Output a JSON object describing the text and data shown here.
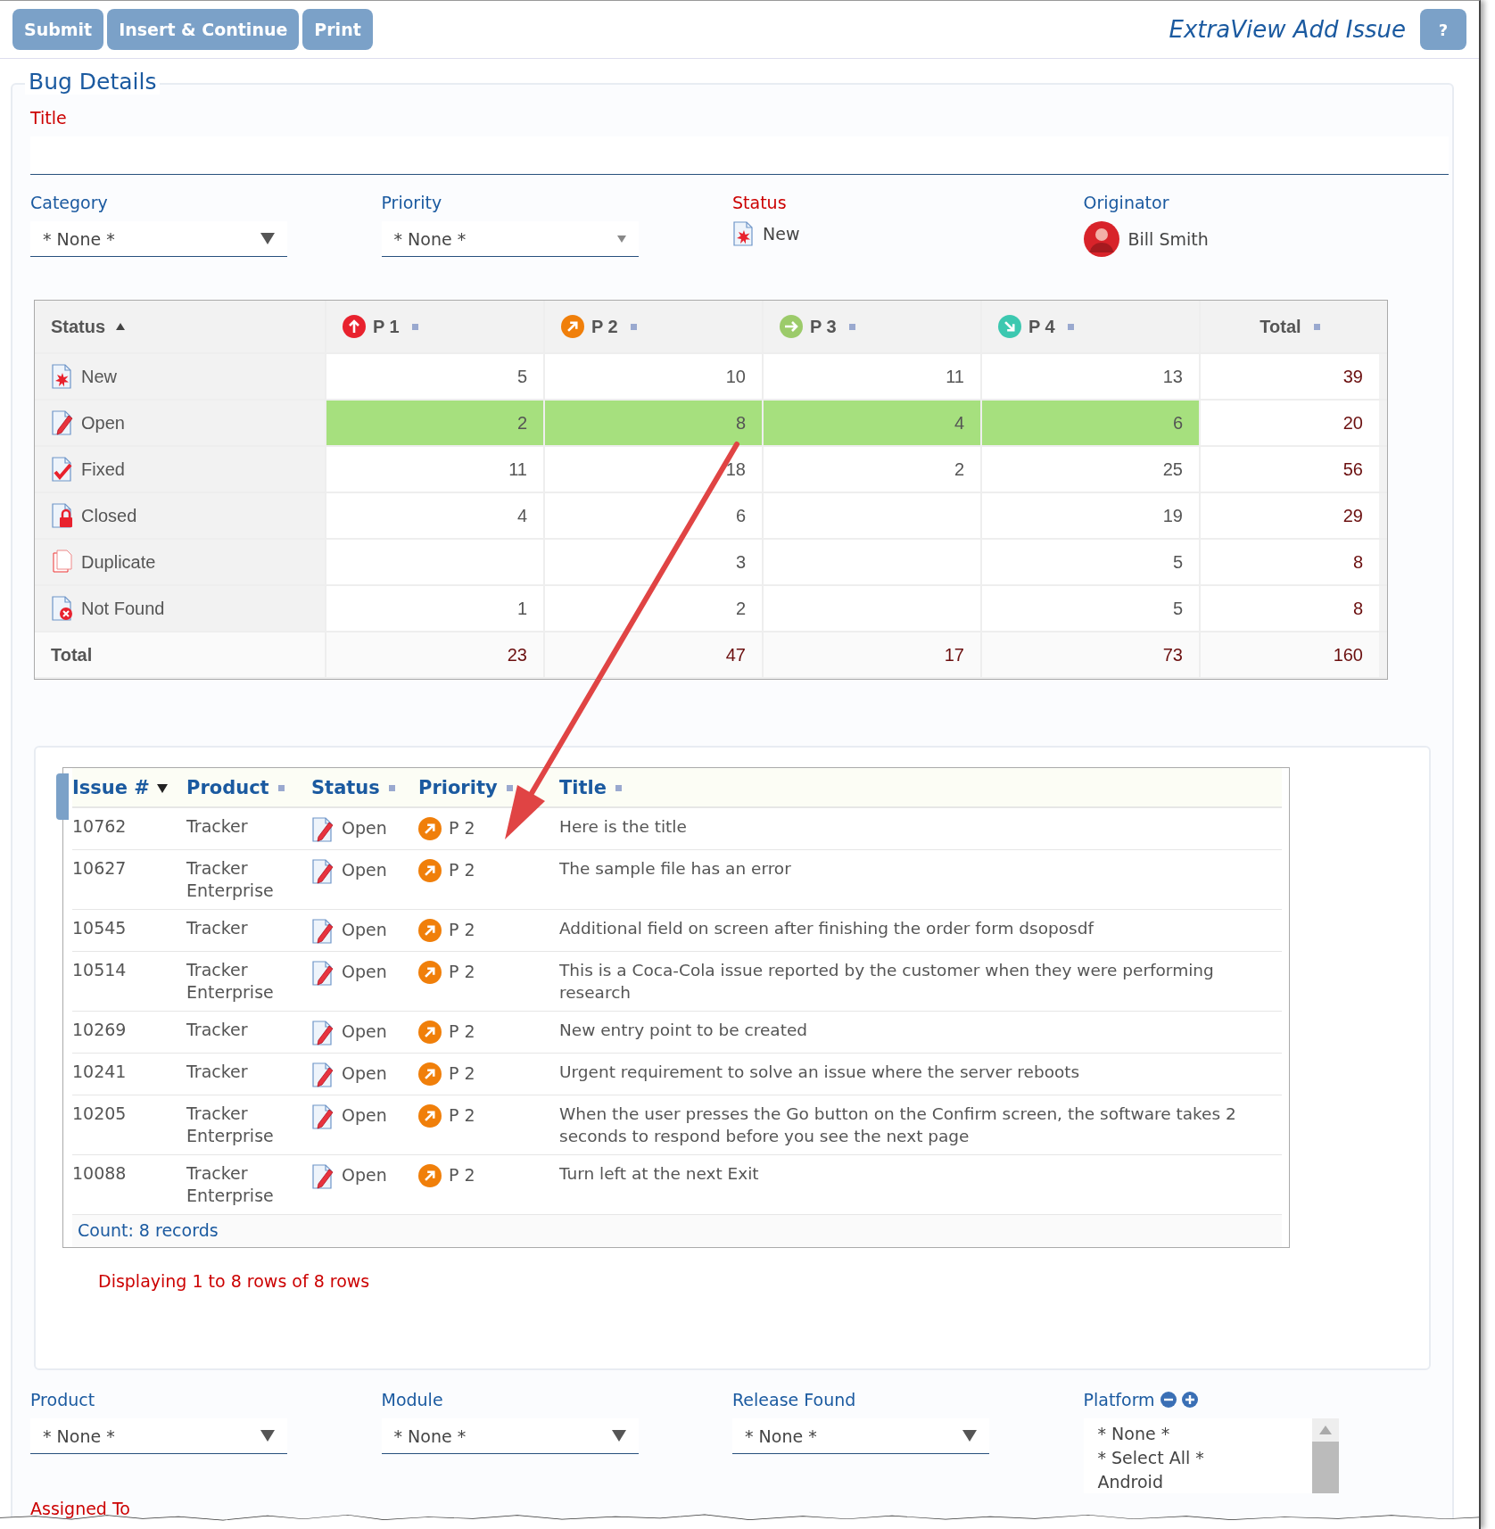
{
  "toolbar": {
    "buttons": [
      "Submit",
      "Insert & Continue",
      "Print"
    ],
    "title": "ExtraView Add Issue",
    "help": "?"
  },
  "section": {
    "title": "Bug Details"
  },
  "title_field": {
    "label": "Title",
    "required": true
  },
  "fields": [
    {
      "label": "Category",
      "required": false,
      "kind": "dropdown",
      "value": "* None *"
    },
    {
      "label": "Priority",
      "required": false,
      "kind": "dropdown_small",
      "value": "* None *"
    },
    {
      "label": "Status",
      "required": true,
      "kind": "status",
      "status": {
        "label": "New",
        "kind": "new"
      }
    },
    {
      "label": "Originator",
      "required": false,
      "kind": "user",
      "value": "Bill Smith"
    }
  ],
  "pivot": {
    "columns": [
      {
        "label": "Status",
        "kind": "status",
        "sorted": true,
        "descending": false
      },
      {
        "label": "P 1",
        "kind": "p1",
        "sorted": false
      },
      {
        "label": "P 2",
        "kind": "p2",
        "sorted": false
      },
      {
        "label": "P 3",
        "kind": "p3",
        "sorted": false
      },
      {
        "label": "P 4",
        "kind": "p4",
        "sorted": false
      },
      {
        "label": "Total",
        "kind": "total",
        "sorted": false
      }
    ],
    "rows": [
      {
        "label": "New",
        "kind": "new",
        "cells": [
          {
            "value": "5",
            "highlighted": false
          },
          {
            "value": "10",
            "highlighted": false
          },
          {
            "value": "11",
            "highlighted": false
          },
          {
            "value": "13",
            "highlighted": false
          },
          {
            "value": "39",
            "highlighted": false
          }
        ]
      },
      {
        "label": "Open",
        "kind": "open",
        "cells": [
          {
            "value": "2",
            "highlighted": true
          },
          {
            "value": "8",
            "highlighted": true
          },
          {
            "value": "4",
            "highlighted": true
          },
          {
            "value": "6",
            "highlighted": true
          },
          {
            "value": "20",
            "highlighted": false
          }
        ]
      },
      {
        "label": "Fixed",
        "kind": "fixed",
        "cells": [
          {
            "value": "11",
            "highlighted": false
          },
          {
            "value": "18",
            "highlighted": false
          },
          {
            "value": "2",
            "highlighted": false
          },
          {
            "value": "25",
            "highlighted": false
          },
          {
            "value": "56",
            "highlighted": false
          }
        ]
      },
      {
        "label": "Closed",
        "kind": "closed",
        "cells": [
          {
            "value": "4",
            "highlighted": false
          },
          {
            "value": "6",
            "highlighted": false
          },
          {
            "highlighted": false
          },
          {
            "value": "19",
            "highlighted": false
          },
          {
            "value": "29",
            "highlighted": false
          }
        ]
      },
      {
        "label": "Duplicate",
        "kind": "duplicate",
        "cells": [
          {
            "highlighted": false
          },
          {
            "value": "3",
            "highlighted": false
          },
          {
            "highlighted": false
          },
          {
            "value": "5",
            "highlighted": false
          },
          {
            "value": "8",
            "highlighted": false
          }
        ]
      },
      {
        "label": "Not Found",
        "kind": "not_found",
        "cells": [
          {
            "value": "1",
            "highlighted": false
          },
          {
            "value": "2",
            "highlighted": false
          },
          {
            "highlighted": false
          },
          {
            "value": "5",
            "highlighted": false
          },
          {
            "value": "8",
            "highlighted": false
          }
        ]
      },
      {
        "label": "Total",
        "kind": "total",
        "cells": [
          {
            "value": "23",
            "highlighted": false
          },
          {
            "value": "47",
            "highlighted": false
          },
          {
            "value": "17",
            "highlighted": false
          },
          {
            "value": "73",
            "highlighted": false
          },
          {
            "value": "160",
            "highlighted": false
          }
        ]
      }
    ]
  },
  "issues": {
    "columns": [
      {
        "label": "Issue #",
        "sorted": true,
        "descending": true
      },
      {
        "label": "Product",
        "sorted": false
      },
      {
        "label": "Status",
        "sorted": false
      },
      {
        "label": "Priority",
        "sorted": false
      },
      {
        "label": "Title",
        "sorted": false
      }
    ],
    "rows": [
      {
        "issue": "10762",
        "product": "Tracker",
        "status": {
          "label": "Open",
          "kind": "open"
        },
        "priority": {
          "label": "P 2",
          "kind": "p2"
        },
        "title": "Here is the title"
      },
      {
        "issue": "10627",
        "product": "Tracker Enterprise",
        "status": {
          "label": "Open",
          "kind": "open"
        },
        "priority": {
          "label": "P 2",
          "kind": "p2"
        },
        "title": "The sample file has an error"
      },
      {
        "issue": "10545",
        "product": "Tracker",
        "status": {
          "label": "Open",
          "kind": "open"
        },
        "priority": {
          "label": "P 2",
          "kind": "p2"
        },
        "title": "Additional field on screen after finishing the order form dsoposdf"
      },
      {
        "issue": "10514",
        "product": "Tracker Enterprise",
        "status": {
          "label": "Open",
          "kind": "open"
        },
        "priority": {
          "label": "P 2",
          "kind": "p2"
        },
        "title": "This is a Coca-Cola issue reported by the customer when they were performing research"
      },
      {
        "issue": "10269",
        "product": "Tracker",
        "status": {
          "label": "Open",
          "kind": "open"
        },
        "priority": {
          "label": "P 2",
          "kind": "p2"
        },
        "title": "New entry point to be created"
      },
      {
        "issue": "10241",
        "product": "Tracker",
        "status": {
          "label": "Open",
          "kind": "open"
        },
        "priority": {
          "label": "P 2",
          "kind": "p2"
        },
        "title": "Urgent requirement to solve an issue where the server reboots"
      },
      {
        "issue": "10205",
        "product": "Tracker Enterprise",
        "status": {
          "label": "Open",
          "kind": "open"
        },
        "priority": {
          "label": "P 2",
          "kind": "p2"
        },
        "title": "When the user presses the Go button on the Confirm screen, the software takes 2 seconds to respond before you see the next page"
      },
      {
        "issue": "10088",
        "product": "Tracker Enterprise",
        "status": {
          "label": "Open",
          "kind": "open"
        },
        "priority": {
          "label": "P 2",
          "kind": "p2"
        },
        "title": "Turn left at the next Exit"
      }
    ],
    "count": "Count: 8 records",
    "paging": "Displaying 1 to 8 rows of 8 rows"
  },
  "bottom_fields": [
    {
      "label": "Product",
      "required": false,
      "kind": "dropdown",
      "value": "* None *"
    },
    {
      "label": "Module",
      "required": false,
      "kind": "dropdown",
      "value": "* None *"
    },
    {
      "label": "Release Found",
      "required": false,
      "kind": "dropdown",
      "value": "* None *"
    },
    {
      "label": "Platform",
      "required": false,
      "kind": "listbox",
      "options": [
        "* None *",
        "* Select All *",
        "Android"
      ]
    }
  ],
  "assigned_to": {
    "label": "Assigned To",
    "required": true
  }
}
